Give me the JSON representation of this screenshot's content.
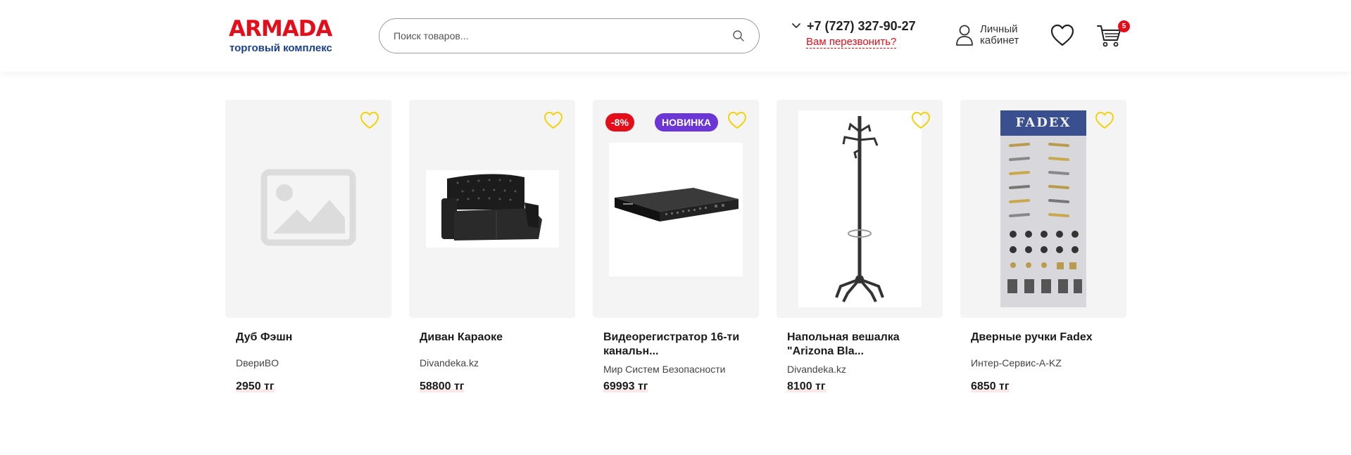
{
  "header": {
    "logo": {
      "brand": "ARMADA",
      "tagline": "торговый комплекс"
    },
    "search": {
      "placeholder": "Поиск товаров..."
    },
    "phone": {
      "number": "+7 (727) 327-90-27",
      "callback_label": "Вам перезвонить?"
    },
    "account": {
      "label": "Личный кабинет"
    },
    "cart": {
      "count": "5"
    }
  },
  "colors": {
    "brand_red": "#e30e1a",
    "brand_blue": "#1c3f8c",
    "new_badge": "#6c35d6",
    "favorite_icon": "#f2d20c",
    "card_bg": "#f4f4f4"
  },
  "products": [
    {
      "name": "Дуб Фэшн",
      "seller": "DвериBO",
      "price": "2950 тг",
      "image": "placeholder-image-icon"
    },
    {
      "name": "Диван Караоке",
      "seller": "Divandeka.kz",
      "price": "58800 тг",
      "image": "sofa"
    },
    {
      "name": "Видеорегистратор 16-ти канальн...",
      "seller": "Мир Систем Безопасности",
      "price": "69993 тг",
      "image": "dvr",
      "badges": {
        "sale": "-8%",
        "new": "НОВИНКА"
      }
    },
    {
      "name": "Напольная вешалка \"Arizona Bla...",
      "seller": "Divandeka.kz",
      "price": "8100 тг",
      "image": "coat-rack"
    },
    {
      "name": "Дверные ручки Fadex",
      "seller": "Интер-Сервис-А-KZ",
      "price": "6850 тг",
      "image": "door-handles",
      "image_text": "FADEX"
    }
  ]
}
